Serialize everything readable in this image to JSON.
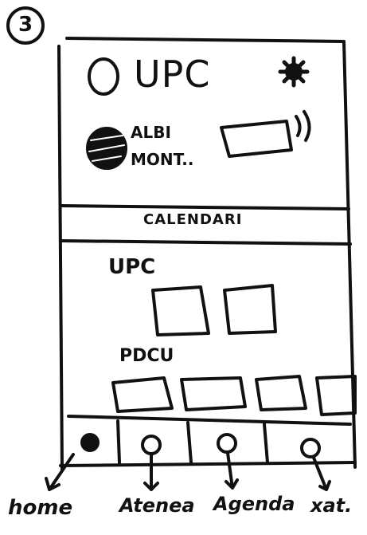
{
  "sketch_number": "3",
  "header": {
    "title": "UPC",
    "user_name_line1": "ALBI",
    "user_name_line2": "MONT.."
  },
  "calendar_bar": {
    "label": "CALENDARI"
  },
  "sections": [
    {
      "title": "UPC",
      "card_count": 2
    },
    {
      "title": "PDCU",
      "card_count": 4
    }
  ],
  "bottom_nav": {
    "items": [
      {
        "label": "home",
        "active": true,
        "icon": "filled-dot-icon"
      },
      {
        "label": "Atenea",
        "active": false,
        "icon": "circle-icon"
      },
      {
        "label": "Agenda",
        "active": false,
        "icon": "circle-icon"
      },
      {
        "label": "xat.",
        "active": false,
        "icon": "circle-icon"
      }
    ]
  }
}
